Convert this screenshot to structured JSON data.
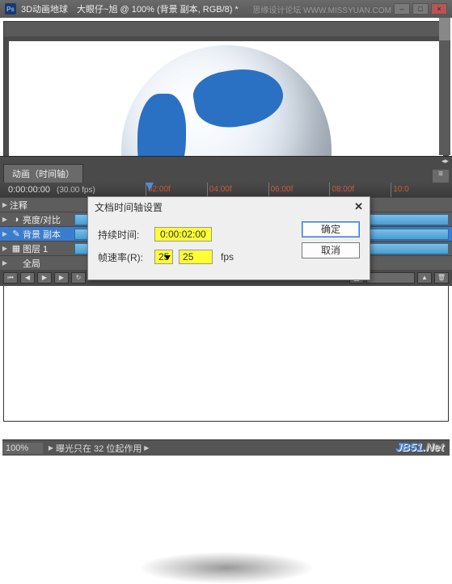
{
  "window": {
    "app_icon": "Ps",
    "title": "3D动画地球　大眼仔~旭 @ 100% (背景 副本, RGB/8) *",
    "watermark": "思缘设计论坛  WWW.MISSYUAN.COM"
  },
  "timeline": {
    "tab_label": "动画（时间轴）",
    "current_time": "0:00:00:00",
    "fps_label": "(30.00 fps)",
    "ticks": [
      "02:00f",
      "04:00f",
      "06:00f",
      "08:00f",
      "10:0"
    ],
    "layers": [
      {
        "name": "注释",
        "icon": "comment",
        "selected": false
      },
      {
        "name": "亮度/对比",
        "icon": "adjust",
        "selected": false
      },
      {
        "name": "背景 副本",
        "icon": "layer",
        "selected": true
      },
      {
        "name": "图层 1",
        "icon": "layer",
        "selected": false
      },
      {
        "name": "全局",
        "icon": "",
        "selected": false
      }
    ]
  },
  "dialog": {
    "title": "文档时间轴设置",
    "duration_label": "持续时间:",
    "duration_value": "0:00:02:00",
    "framerate_label": "帧速率(R):",
    "framerate_select": "25",
    "framerate_input": "25",
    "fps_unit": "fps",
    "ok_label": "确定",
    "cancel_label": "取消"
  },
  "statusbar": {
    "zoom": "100%",
    "info": "曝光只在 32 位起作用"
  },
  "watermark2": {
    "a": "JB51.",
    "b": "Net"
  }
}
